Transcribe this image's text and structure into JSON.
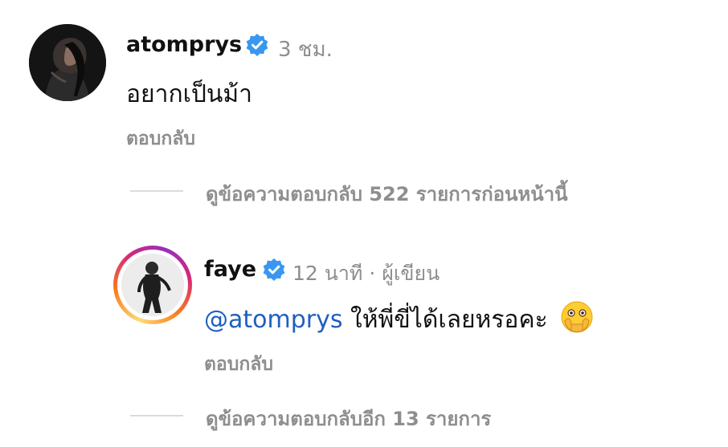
{
  "comment": {
    "username": "atomprys",
    "timestamp": "3 ชม.",
    "text": "อยากเป็นม้า",
    "reply_label": "ตอบกลับ"
  },
  "view_previous_replies": "ดูข้อความตอบกลับ 522 รายการก่อนหน้านี้",
  "reply": {
    "username": "faye",
    "meta": "12 นาที · ผู้เขียน",
    "mention": "@atomprys",
    "text": "ให้พี่ขี่ได้เลยหรอคะ",
    "emoji": "face-with-open-eyes-and-hand-over-mouth",
    "reply_label": "ตอบกลับ"
  },
  "view_more_replies": "ดูข้อความตอบกลับอีก 13 รายการ",
  "colors": {
    "verified_blue": "#3897f0",
    "mention_blue": "#1f5fbf",
    "secondary_text": "#8e8e8e",
    "divider": "#dbdbdb"
  }
}
